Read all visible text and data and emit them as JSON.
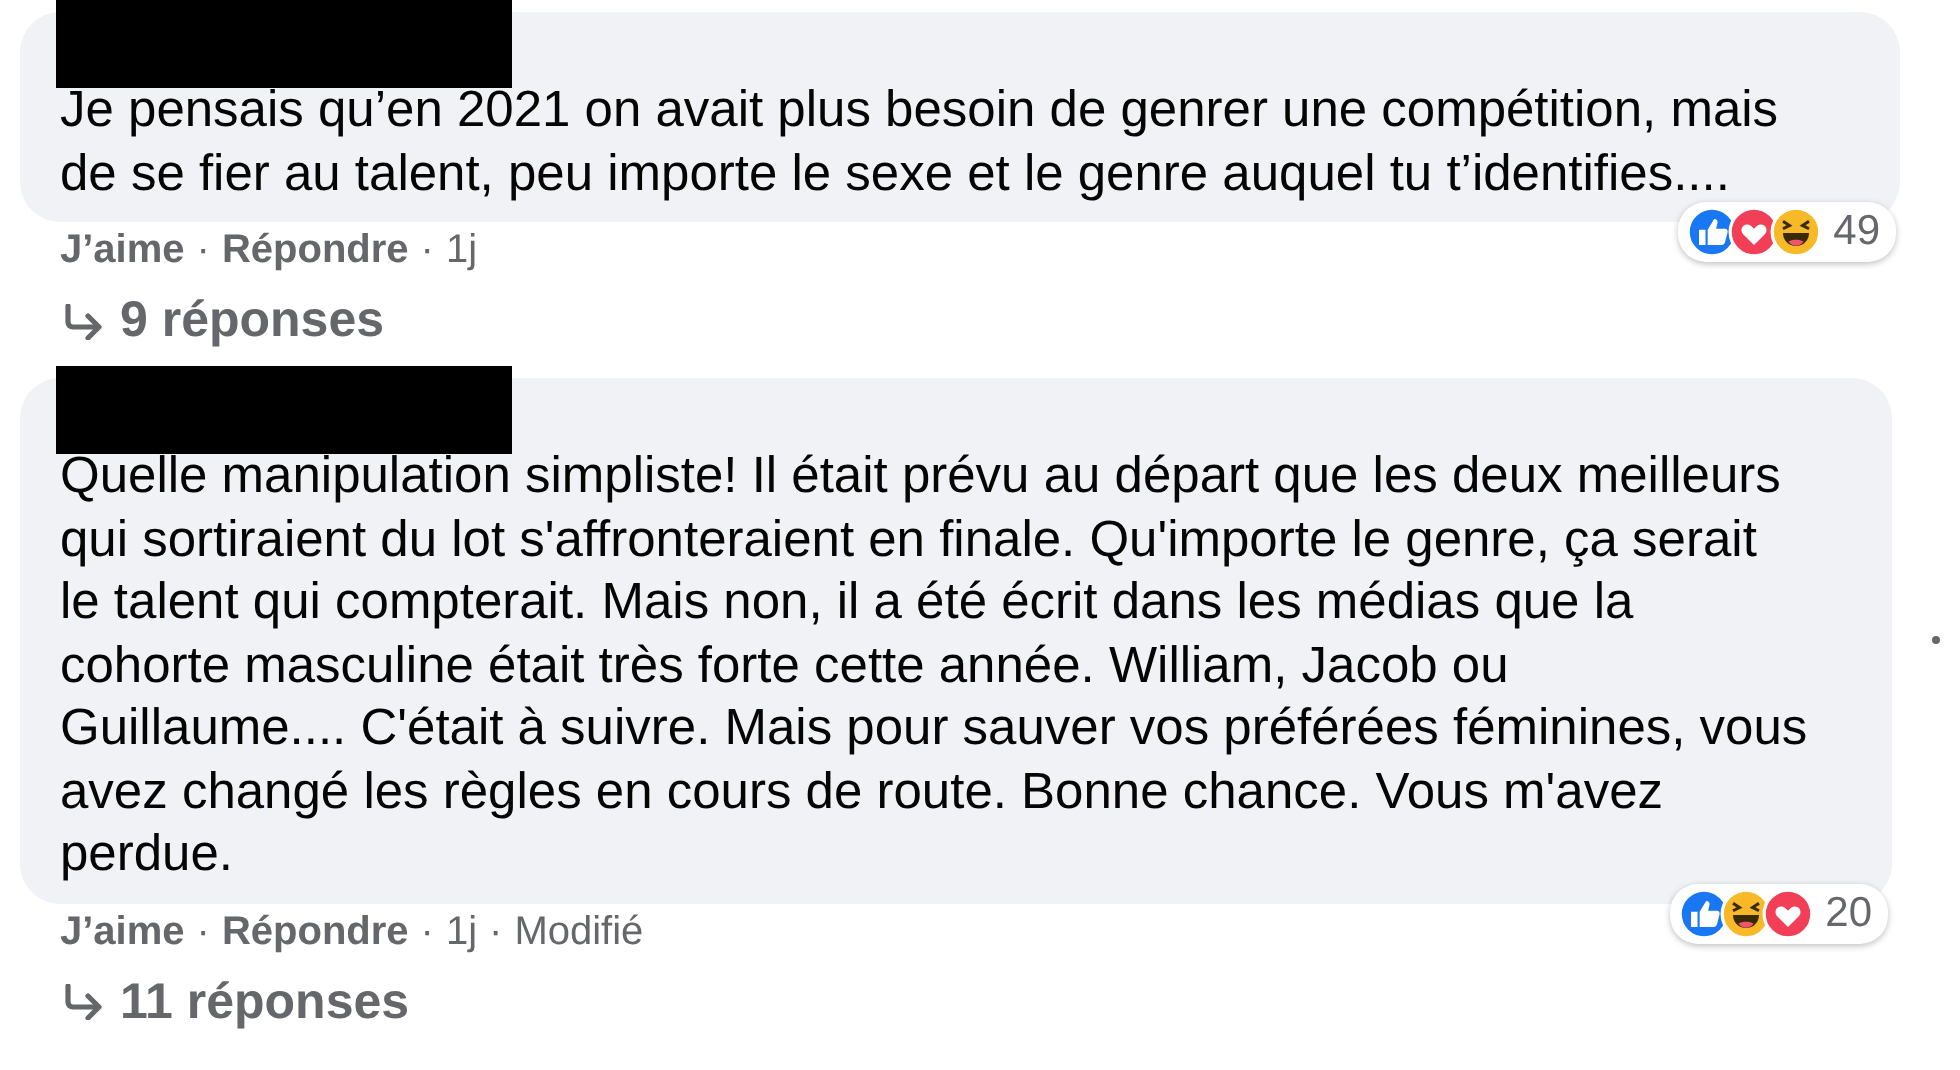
{
  "comments": [
    {
      "redacted": true,
      "text": "Je pensais qu’en 2021 on avait plus besoin de genrer une compétition, mais\nde se fier au talent, peu importe le sexe et le genre auquel tu t’identifies....",
      "reactions": {
        "icons": [
          {
            "kind": "like"
          },
          {
            "kind": "love"
          },
          {
            "kind": "haha"
          }
        ],
        "count": "49"
      },
      "meta": [
        {
          "kind": "link",
          "text": "J’aime"
        },
        {
          "kind": "sep",
          "text": "·"
        },
        {
          "kind": "link",
          "text": "Répondre"
        },
        {
          "kind": "sep",
          "text": "·"
        },
        {
          "kind": "info",
          "text": "1j"
        }
      ],
      "replies": "9 réponses",
      "more_menu": false
    },
    {
      "redacted": true,
      "text": "Quelle manipulation simpliste! Il était prévu au départ que les deux meilleurs\nqui sortiraient du lot s'affronteraient en finale. Qu'importe le genre, ça serait\nle talent qui compterait. Mais non, il a été écrit dans les médias que la\ncohorte masculine était très forte cette année. William, Jacob ou\nGuillaume.... C'était à suivre. Mais pour sauver vos préférées féminines, vous\navez changé les règles en cours de route. Bonne chance. Vous m'avez\nperdue.",
      "reactions": {
        "icons": [
          {
            "kind": "like"
          },
          {
            "kind": "haha"
          },
          {
            "kind": "love"
          }
        ],
        "count": "20"
      },
      "meta": [
        {
          "kind": "link",
          "text": "J’aime"
        },
        {
          "kind": "sep",
          "text": "·"
        },
        {
          "kind": "link",
          "text": "Répondre"
        },
        {
          "kind": "sep",
          "text": "·"
        },
        {
          "kind": "info",
          "text": "1j"
        },
        {
          "kind": "sep",
          "text": "·"
        },
        {
          "kind": "info",
          "text": "Modifié"
        }
      ],
      "replies": "11 réponses",
      "more_menu": true
    }
  ]
}
